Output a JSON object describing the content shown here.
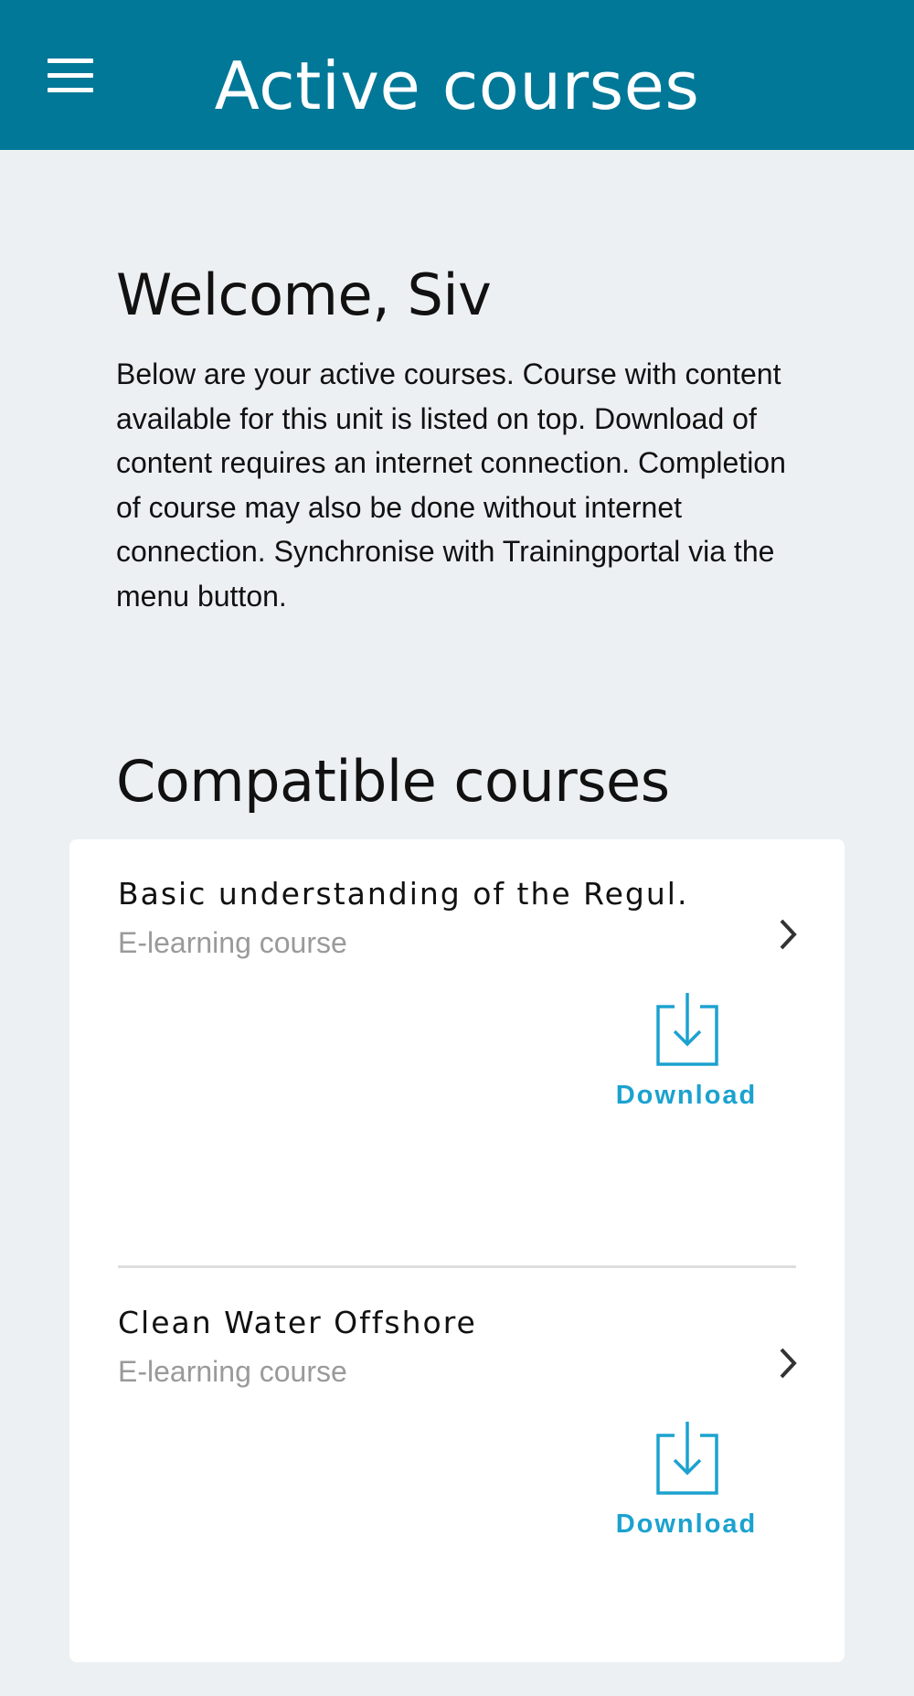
{
  "header": {
    "title": "Active courses",
    "menu_icon": "hamburger-menu-icon"
  },
  "welcome": {
    "title": "Welcome, Siv",
    "text": "Below are your active courses. Course with content available for this unit is listed on top. Download of content requires an internet connection. Completion of course may also be done without internet connection. Synchronise with Trainingportal via the menu button."
  },
  "section": {
    "title": "Compatible courses"
  },
  "courses": [
    {
      "title": "Basic understanding of the Regul...",
      "type": "E-learning course",
      "download_label": "Download"
    },
    {
      "title": "Clean Water Offshore",
      "type": "E-learning course",
      "download_label": "Download"
    }
  ],
  "colors": {
    "header_bg": "#017898",
    "accent": "#1ba2cf",
    "page_bg": "#edf0f2"
  }
}
